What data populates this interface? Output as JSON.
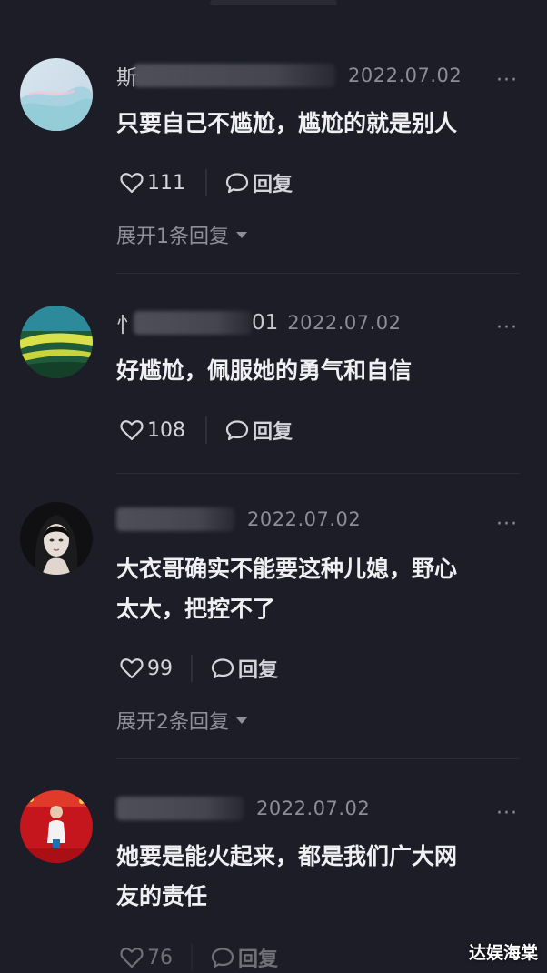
{
  "comments": [
    {
      "name_prefix": "斯",
      "date": "2022.07.02",
      "text": "只要自己不尴尬，尴尬的就是别人",
      "likes": "111",
      "reply_label": "回复",
      "expand_label": "展开1条回复",
      "avatar_icon": "landscape-avatar"
    },
    {
      "name_prefix": "忄",
      "name_suffix": "01",
      "date": "2022.07.02",
      "text": "好尴尬，佩服她的勇气和自信",
      "likes": "108",
      "reply_label": "回复",
      "avatar_icon": "green-stripes-avatar"
    },
    {
      "name_prefix": "",
      "date": "2022.07.02",
      "text_line1": "大衣哥确实不能要这种儿媳，野心",
      "text_line2": "太大，把控不了",
      "likes": "99",
      "reply_label": "回复",
      "expand_label": "展开2条回复",
      "avatar_icon": "portrait-avatar"
    },
    {
      "name_prefix": "",
      "date": "2022.07.02",
      "text_line1": "她要是能火起来，都是我们广大网",
      "text_line2": "友的责任",
      "likes": "76",
      "reply_label": "回复",
      "avatar_icon": "red-stage-avatar"
    }
  ],
  "more_label": "···",
  "watermark": "达娱海棠",
  "colors": {
    "background": "#1c1d27",
    "text": "#f0f0f3",
    "meta": "#8c8d97"
  }
}
